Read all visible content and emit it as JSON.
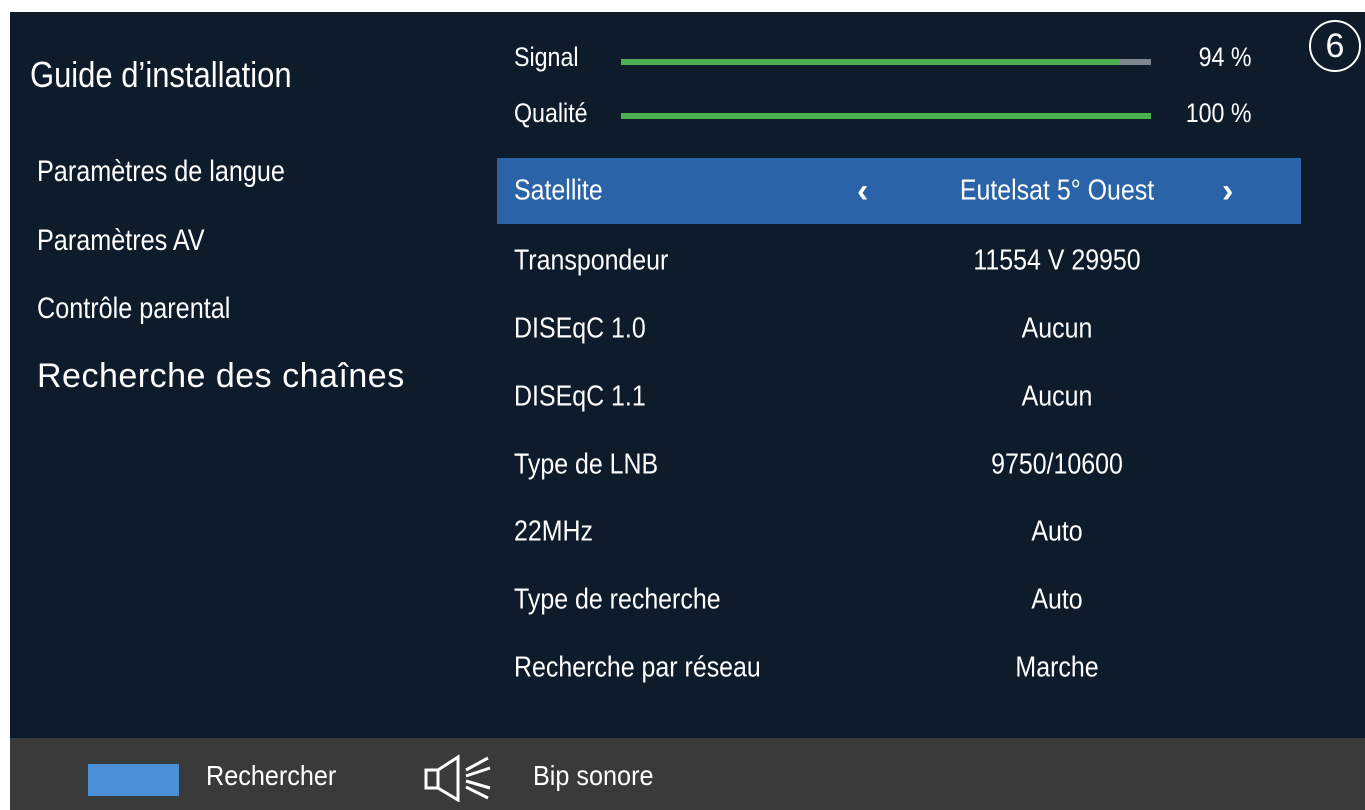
{
  "page_number": "6",
  "sidebar": {
    "title": "Guide d’installation",
    "items": [
      {
        "label": "Paramètres de langue",
        "active": false
      },
      {
        "label": "Paramètres AV",
        "active": false
      },
      {
        "label": "Contrôle parental",
        "active": false
      },
      {
        "label": "Recherche des chaînes",
        "active": true
      }
    ]
  },
  "meters": [
    {
      "label": "Signal",
      "value_text": "94 %",
      "percent": 94
    },
    {
      "label": "Qualité",
      "value_text": "100 %",
      "percent": 100
    }
  ],
  "settings": [
    {
      "label": "Satellite",
      "value": "Eutelsat 5° Ouest",
      "selected": true
    },
    {
      "label": "Transpondeur",
      "value": "11554 V  29950",
      "selected": false
    },
    {
      "label": "DISEqC 1.0",
      "value": "Aucun",
      "selected": false
    },
    {
      "label": "DISEqC 1.1",
      "value": "Aucun",
      "selected": false
    },
    {
      "label": "Type de LNB",
      "value": "9750/10600",
      "selected": false
    },
    {
      "label": "22MHz",
      "value": "Auto",
      "selected": false
    },
    {
      "label": "Type de recherche",
      "value": "Auto",
      "selected": false
    },
    {
      "label": "Recherche par réseau",
      "value": "Marche",
      "selected": false
    }
  ],
  "arrows": {
    "left": "‹",
    "right": "›"
  },
  "bottom_bar": {
    "blue_key_label": "Rechercher",
    "sound_label": "Bip sonore"
  },
  "colors": {
    "background": "#0d1b2a",
    "selected_row": "#2a63a8",
    "meter_fill": "#4caf50",
    "meter_track": "#7d8590",
    "bottom_bar": "#3a3a3a",
    "blue_key": "#4a90d9"
  },
  "icons": {
    "blue_key": "blue-key-swatch",
    "sound": "speaker-icon",
    "left_arrow": "chevron-left-icon",
    "right_arrow": "chevron-right-icon"
  }
}
